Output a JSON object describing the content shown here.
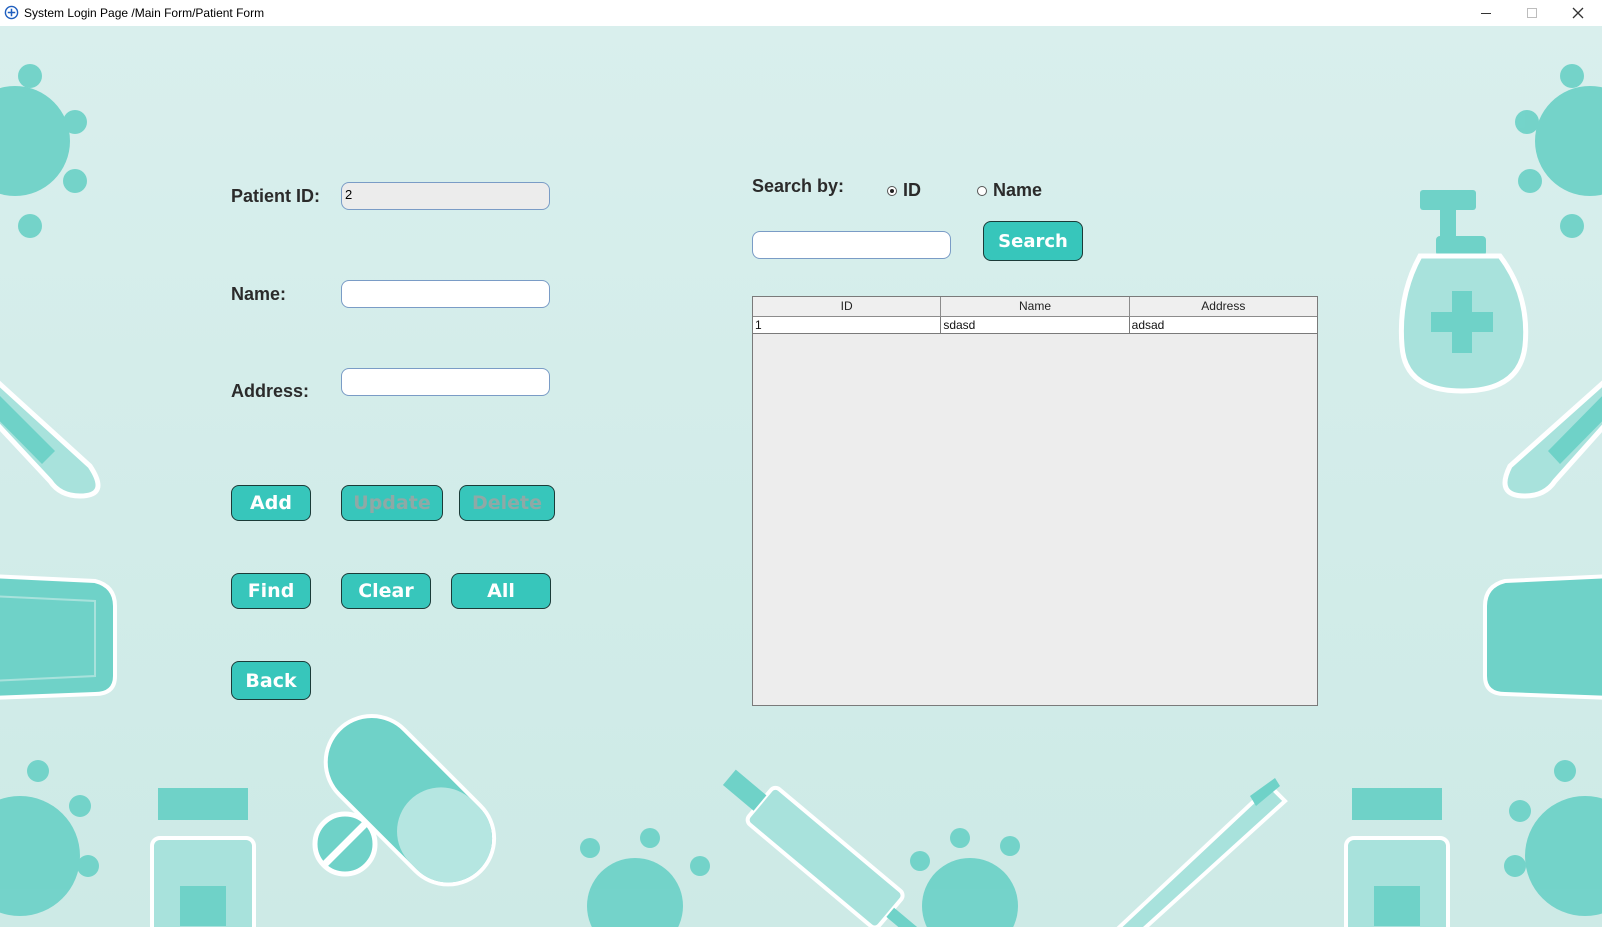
{
  "window": {
    "title": "System Login Page /Main Form/Patient Form",
    "minimize_icon": "minimize-icon",
    "maximize_icon": "maximize-icon",
    "close_icon": "close-icon"
  },
  "form": {
    "patient_id_label": "Patient ID:",
    "patient_id_value": "2",
    "name_label": "Name:",
    "name_value": "",
    "address_label": "Address:",
    "address_value": ""
  },
  "buttons": {
    "add": "Add",
    "update": "Update",
    "delete": "Delete",
    "find": "Find",
    "clear": "Clear",
    "all": "All",
    "back": "Back",
    "search": "Search"
  },
  "search": {
    "label": "Search by:",
    "options": [
      {
        "label": "ID",
        "selected": true
      },
      {
        "label": "Name",
        "selected": false
      }
    ],
    "value": ""
  },
  "table": {
    "columns": [
      "ID",
      "Name",
      "Address"
    ],
    "rows": [
      [
        "1",
        "sdasd",
        "adsad"
      ]
    ]
  },
  "colors": {
    "accent": "#37c6bb",
    "background": "#d6eeeb",
    "decor": "#6fd2c8"
  }
}
